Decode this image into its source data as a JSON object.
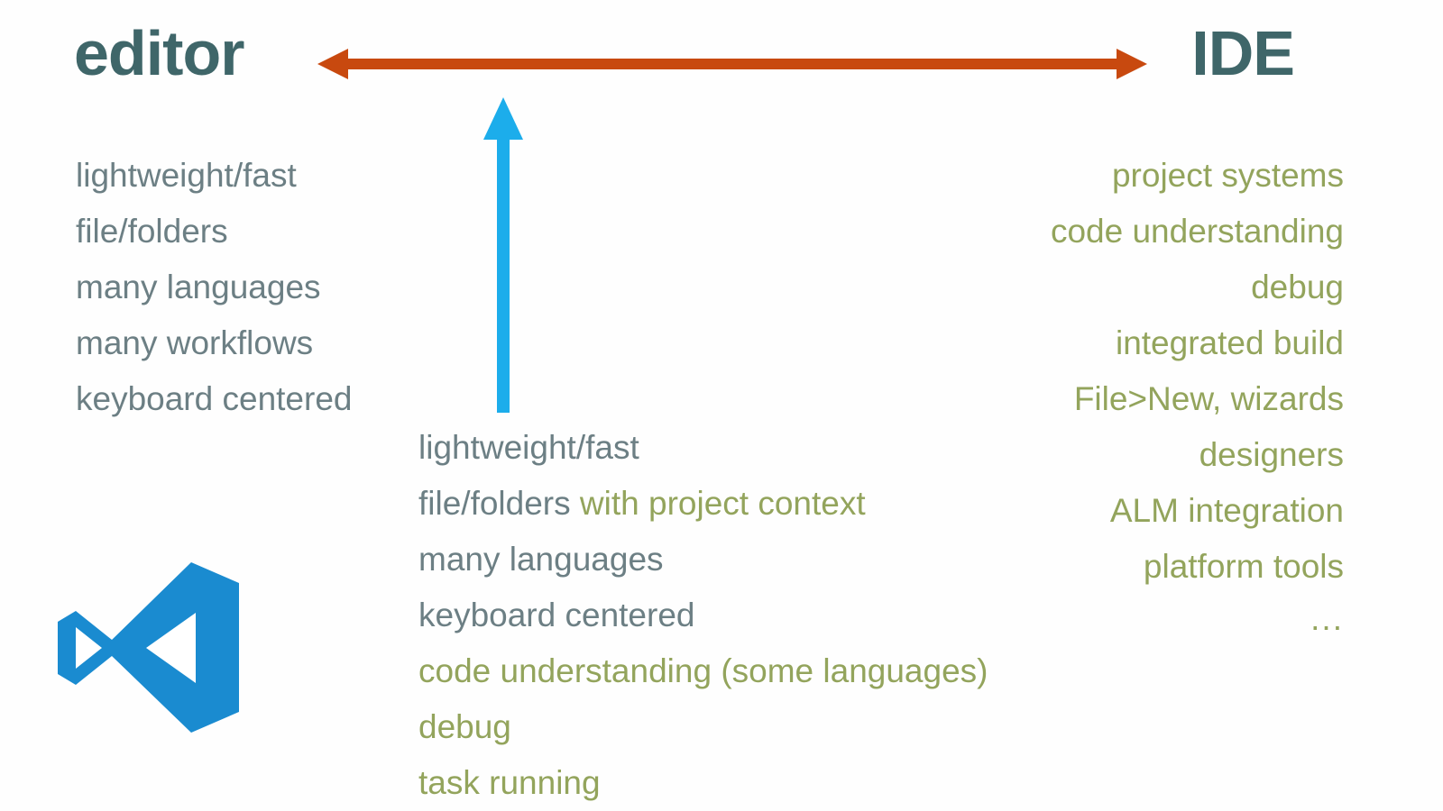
{
  "slide": {
    "background_color": "#fefefe",
    "heading_color": "#3f6669",
    "blue_text_color": "#6c7f84",
    "green_text_color": "#93a45c",
    "orange_arrow_color": "#c8490f",
    "blue_arrow_color": "#1cadeb",
    "logo_color": "#1a8bd0"
  },
  "headings": {
    "left": "editor",
    "right": "IDE"
  },
  "arrows": {
    "horizontal": {
      "name": "spectrum-double-arrow",
      "color": "#c8490f",
      "direction": "both"
    },
    "vertical": {
      "name": "positioning-up-arrow",
      "color": "#1cadeb",
      "direction": "up"
    }
  },
  "columns": {
    "editor": {
      "align": "left",
      "items": [
        {
          "text": "lightweight/fast",
          "color": "blue"
        },
        {
          "text": "file/folders",
          "color": "blue"
        },
        {
          "text": "many languages",
          "color": "blue"
        },
        {
          "text": "many workflows",
          "color": "blue"
        },
        {
          "text": "keyboard centered",
          "color": "blue"
        }
      ]
    },
    "ide": {
      "align": "right",
      "items": [
        {
          "text": "project systems",
          "color": "green"
        },
        {
          "text": "code understanding",
          "color": "green"
        },
        {
          "text": "debug",
          "color": "green"
        },
        {
          "text": "integrated build",
          "color": "green"
        },
        {
          "text": "File>New, wizards",
          "color": "green"
        },
        {
          "text": "designers",
          "color": "green"
        },
        {
          "text": "ALM integration",
          "color": "green"
        },
        {
          "text": "platform tools",
          "color": "green"
        }
      ],
      "ellipsis": "..."
    },
    "vscode": {
      "align": "left",
      "items": [
        {
          "parts": [
            {
              "text": "lightweight/fast",
              "color": "blue"
            }
          ]
        },
        {
          "parts": [
            {
              "text": "file/folders ",
              "color": "blue"
            },
            {
              "text": "with project context",
              "color": "green"
            }
          ]
        },
        {
          "parts": [
            {
              "text": "many languages",
              "color": "blue"
            }
          ]
        },
        {
          "parts": [
            {
              "text": "keyboard centered",
              "color": "blue"
            }
          ]
        },
        {
          "parts": [
            {
              "text": "code understanding (some languages)",
              "color": "green"
            }
          ]
        },
        {
          "parts": [
            {
              "text": "debug",
              "color": "green"
            }
          ]
        },
        {
          "parts": [
            {
              "text": "task running",
              "color": "green"
            }
          ]
        }
      ]
    }
  },
  "logo": {
    "name": "visual-studio-code-logo",
    "label": "Visual Studio Code"
  }
}
